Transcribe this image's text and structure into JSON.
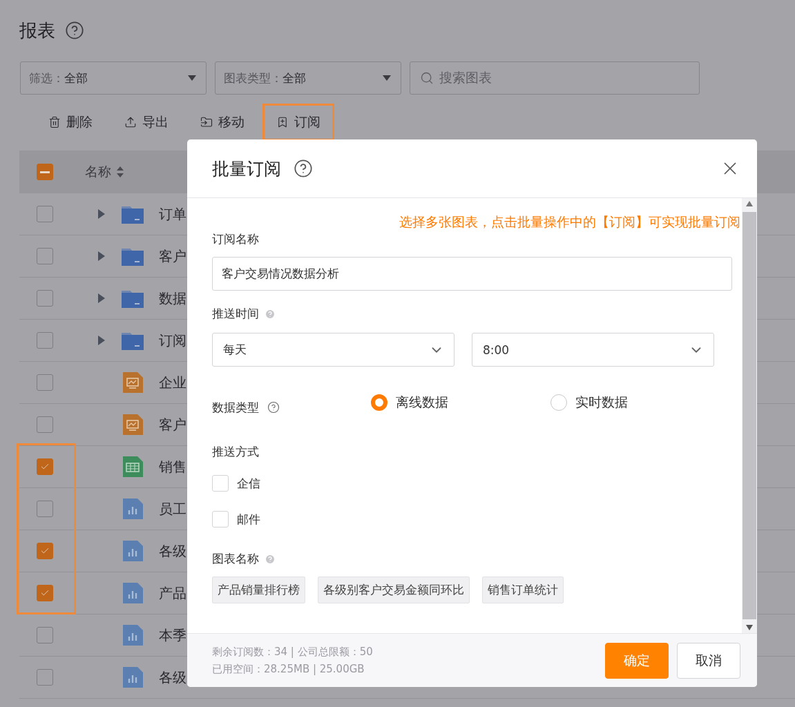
{
  "page": {
    "title": "报表"
  },
  "filters": [
    {
      "label": "筛选：",
      "value": "全部"
    },
    {
      "label": "图表类型：",
      "value": "全部"
    }
  ],
  "search": {
    "placeholder": "搜索图表"
  },
  "toolbar": [
    {
      "label": "删除",
      "kind": "delete",
      "highlighted": false
    },
    {
      "label": "导出",
      "kind": "export",
      "highlighted": false
    },
    {
      "label": "移动",
      "kind": "move",
      "highlighted": false
    },
    {
      "label": "订阅",
      "kind": "subscribe",
      "highlighted": true
    }
  ],
  "table": {
    "column": "名称",
    "select_all_indeterminate": true,
    "rows": [
      {
        "name": "订单",
        "kind": "folder",
        "checked": false,
        "highlighted": false
      },
      {
        "name": "客户",
        "kind": "folder",
        "checked": false,
        "highlighted": false
      },
      {
        "name": "数据",
        "kind": "folder",
        "checked": false,
        "highlighted": false
      },
      {
        "name": "订阅",
        "kind": "folder",
        "checked": false,
        "highlighted": false
      },
      {
        "name": "企业",
        "kind": "dashboard",
        "checked": false,
        "highlighted": false
      },
      {
        "name": "客户",
        "kind": "dashboard",
        "checked": false,
        "highlighted": false
      },
      {
        "name": "销售",
        "kind": "table",
        "checked": true,
        "highlighted": true
      },
      {
        "name": "员工",
        "kind": "chart",
        "checked": false,
        "highlighted": true
      },
      {
        "name": "各级",
        "kind": "chart",
        "checked": true,
        "highlighted": true
      },
      {
        "name": "产品",
        "kind": "chart",
        "checked": true,
        "highlighted": true
      },
      {
        "name": "本季",
        "kind": "chart",
        "checked": false,
        "highlighted": false
      },
      {
        "name": "各级",
        "kind": "chart",
        "checked": false,
        "highlighted": false
      }
    ]
  },
  "dialog": {
    "title": "批量订阅",
    "tip": "选择多张图表，点击批量操作中的【订阅】可实现批量订阅",
    "subscription_name": {
      "label": "订阅名称",
      "value": "客户交易情况数据分析"
    },
    "push_time": {
      "label": "推送时间",
      "frequency": "每天",
      "time": "8:00"
    },
    "data_type": {
      "label": "数据类型",
      "options": [
        {
          "label": "离线数据",
          "selected": true
        },
        {
          "label": "实时数据",
          "selected": false
        }
      ]
    },
    "push_method": {
      "label": "推送方式",
      "options": [
        {
          "label": "企信",
          "checked": false
        },
        {
          "label": "邮件",
          "checked": false
        }
      ]
    },
    "charts": {
      "label": "图表名称",
      "tags": [
        "产品销量排行榜",
        "各级别客户交易金额同环比",
        "销售订单统计"
      ]
    },
    "footer": {
      "quota": "剩余订阅数：34 | 公司总限额：50",
      "storage": "已用空间：28.25MB | 25.00GB",
      "buttons": [
        {
          "label": "确定",
          "kind": "primary"
        },
        {
          "label": "取消",
          "kind": "secondary"
        }
      ]
    }
  }
}
